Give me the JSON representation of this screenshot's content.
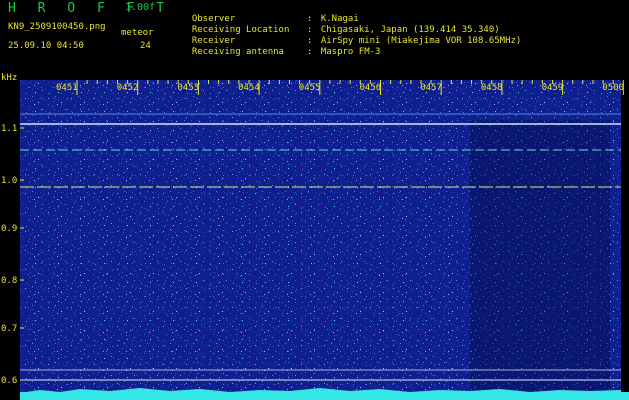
{
  "header": {
    "app_title": "H R O F F T",
    "version": "1.00f",
    "filename": "KN9_2509100450.png",
    "timestamp": "25.09.10 04:50",
    "meteor_label": "meteor",
    "meteor_count": "24"
  },
  "metadata": {
    "rows": [
      {
        "label": "Observer",
        "sep": ":",
        "value": "K.Nagai"
      },
      {
        "label": "Receiving Location",
        "sep": ":",
        "value": "Chigasaki, Japan (139.414 35.340)"
      },
      {
        "label": "Receiver",
        "sep": ":",
        "value": "AirSpy mini (Miakejima VOR 108.65MHz)"
      },
      {
        "label": "Receiving antenna",
        "sep": ":",
        "value": "Maspro FM-3"
      }
    ]
  },
  "spectrogram": {
    "y_unit": "kHz",
    "y_ticks": [
      "1.1",
      "1.0",
      "0.9",
      "0.8",
      "0.7",
      "0.6"
    ],
    "time_ticks": [
      "0451",
      "0452",
      "0453",
      "0454",
      "0455",
      "0456",
      "0457",
      "0458",
      "0459",
      "0500"
    ],
    "colors": {
      "background": "#101f8e",
      "label": "#e6e62a",
      "title": "#17c84b",
      "signal": "#35e6e6"
    }
  }
}
